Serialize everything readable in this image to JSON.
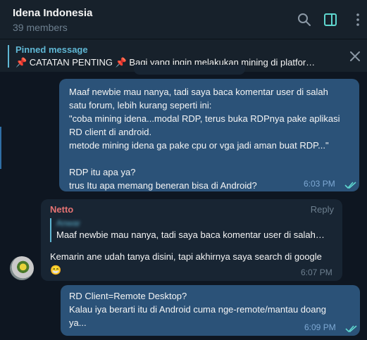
{
  "header": {
    "title": "Idena Indonesia",
    "members": "39 members",
    "icons": [
      "search-icon",
      "sidebar-toggle-icon",
      "more-vert-icon"
    ]
  },
  "pinned": {
    "label": "Pinned message",
    "text": "📌 CATATAN PENTING 📌 Bagi yang ingin melakukan mining di platfor…"
  },
  "messages": [
    {
      "direction": "outgoing",
      "text": "Maaf newbie mau nanya, tadi saya baca komentar user di salah\nsatu forum, lebih kurang seperti ini:\n\"coba mining idena...modal RDP, terus buka RDPnya pake aplikasi\nRD client di android.\nmetode mining idena ga pake cpu or vga jadi aman buat RDP...\"\n\nRDP itu apa ya?\ntrus Itu apa memang beneran bisa di Android?",
      "time": "6:03 PM",
      "status": "read"
    },
    {
      "direction": "incoming",
      "sender": "Netto",
      "reply_action": "Reply",
      "quote_text": "Maaf newbie mau nanya, tadi saya baca komentar user di salah…",
      "text": "Kemarin ane udah tanya disini, tapi akhirnya saya search di google\n😁",
      "time": "6:07 PM"
    },
    {
      "direction": "outgoing",
      "text": "RD Client=Remote Desktop?\nKalau iya berarti itu di Android cuma nge-remote/mantau doang\nya...",
      "time": "6:09 PM",
      "status": "read"
    }
  ],
  "colors": {
    "background": "#0e1621",
    "header": "#17212b",
    "outgoing_bubble": "#2b5278",
    "incoming_bubble": "#182533",
    "accent": "#5fb7d4",
    "sender_name": "#e57373"
  }
}
